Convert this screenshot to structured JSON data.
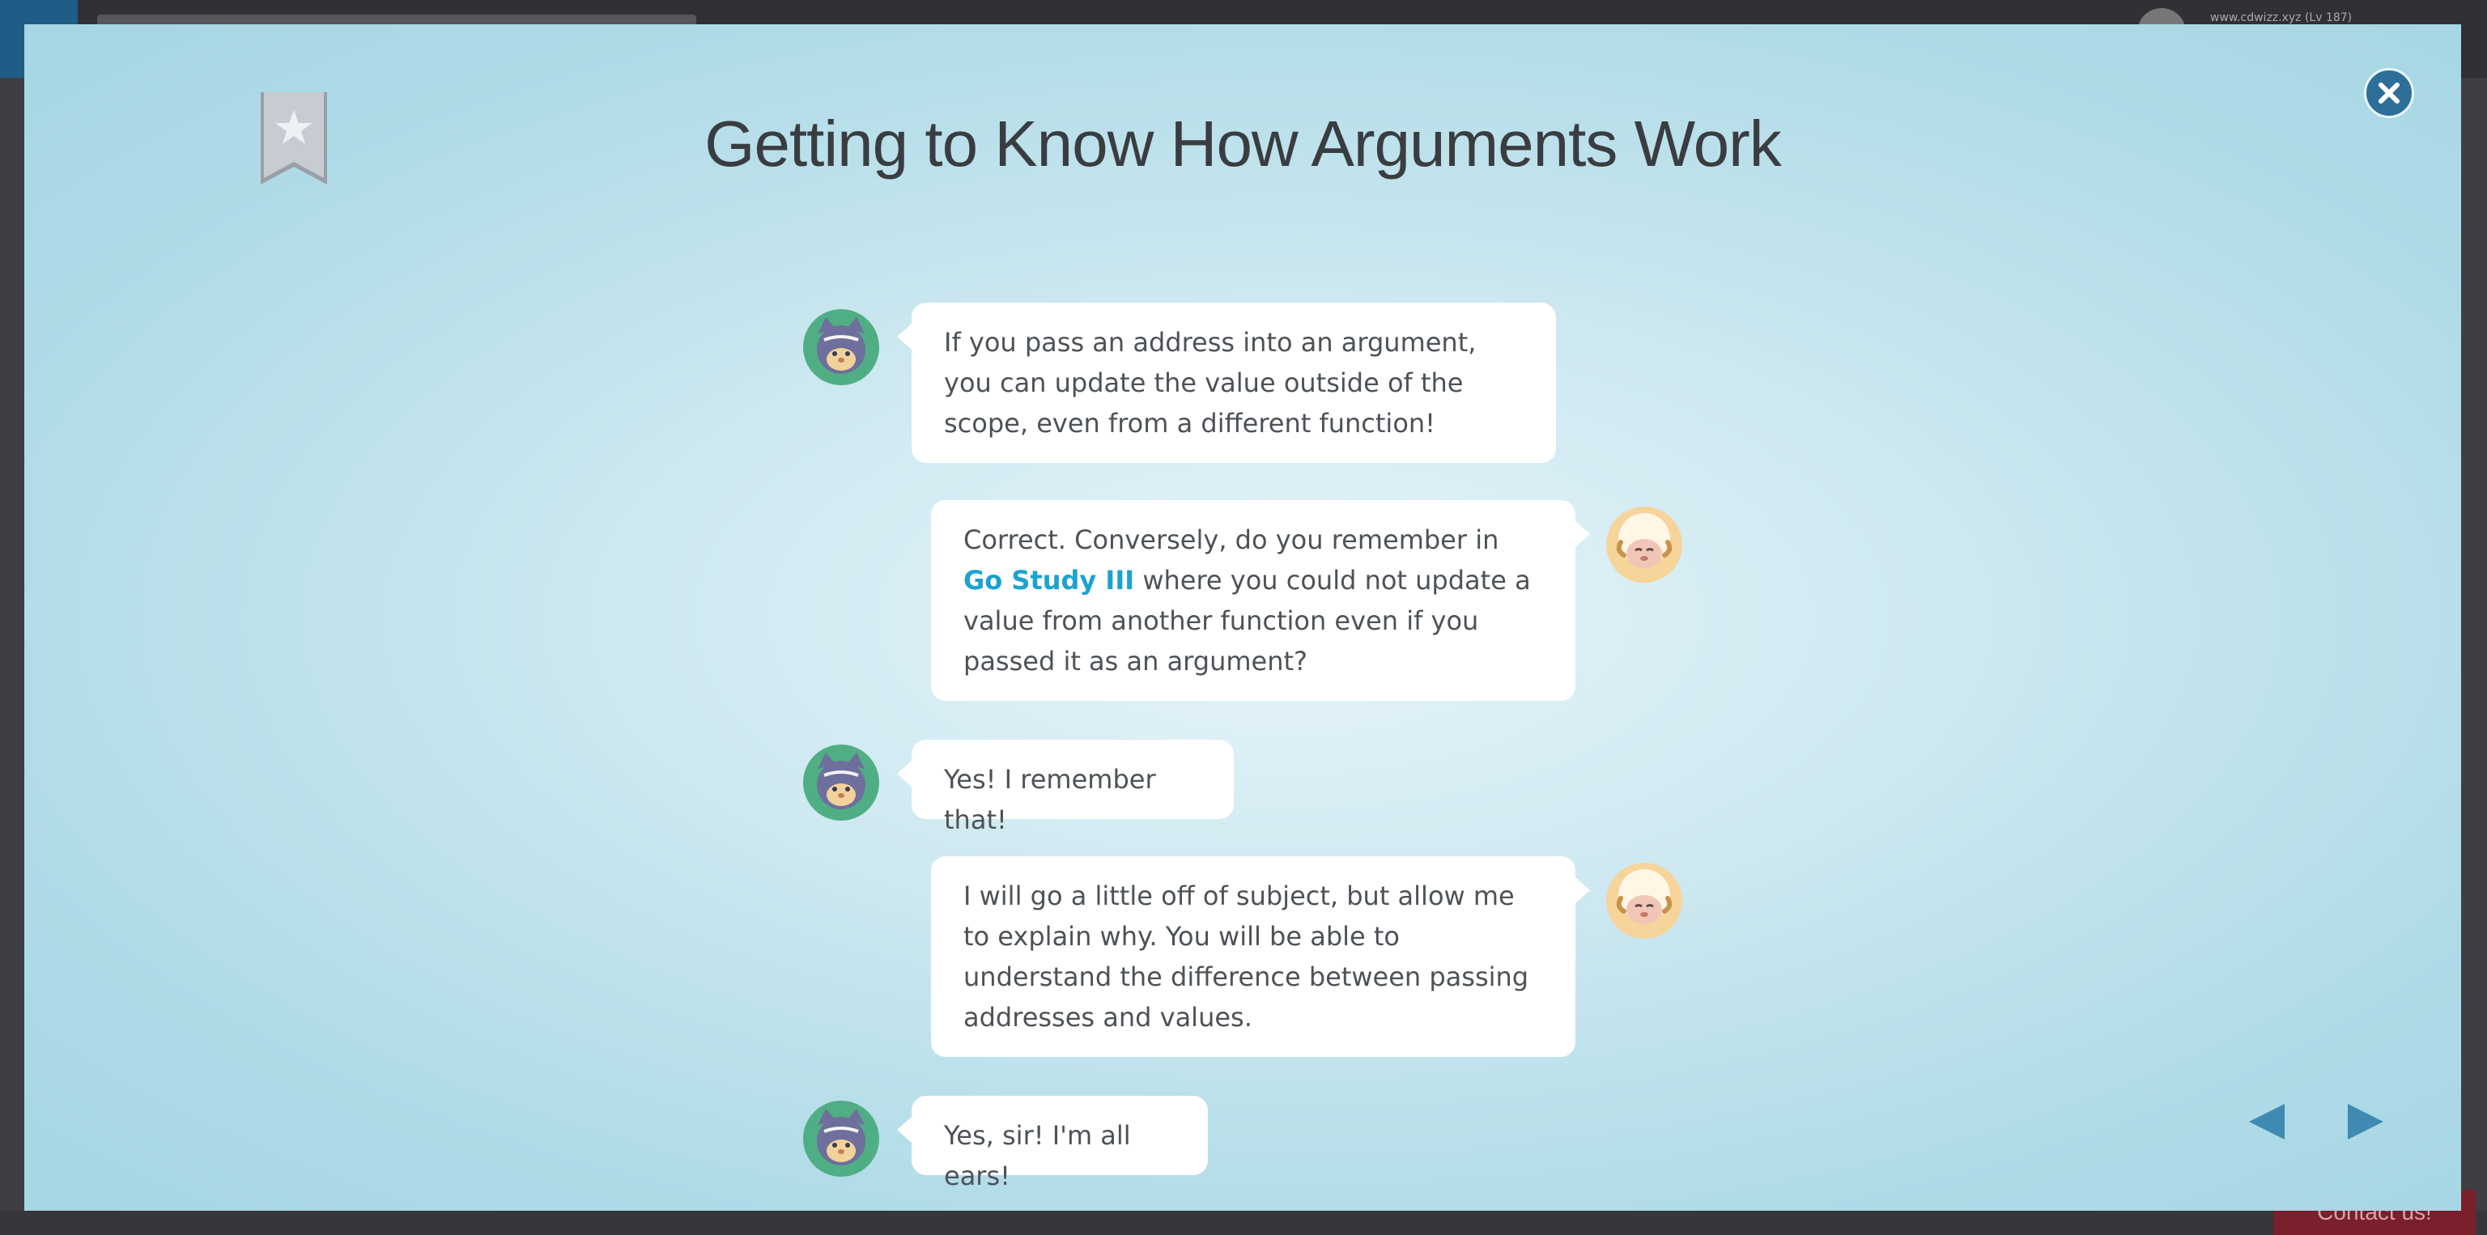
{
  "background": {
    "user_info": "www.cdwizz.xyz (Lv 187)",
    "contact_label": "Contact us!"
  },
  "modal": {
    "title": "Getting to Know How Arguments Work",
    "close_icon": "close-icon",
    "bookmark_icon": "star-bookmark-icon",
    "colors": {
      "accent": "#2e6f99",
      "link": "#1ca2cf",
      "text": "#4d5257"
    }
  },
  "dialogue": [
    {
      "speaker": "cat",
      "text": "If you pass an address into an argument, you can update the value outside of the scope, even from a different function!"
    },
    {
      "speaker": "sheep",
      "text_before": "Correct. Conversely, do you remember in ",
      "link_text": "Go Study III",
      "text_after": " where you could not update a value from another function even if you passed it as an argument?"
    },
    {
      "speaker": "cat",
      "text": "Yes! I remember that!"
    },
    {
      "speaker": "sheep",
      "text": "I will go a little off of subject, but allow me to explain why. You will be able to understand the difference between passing addresses and values."
    },
    {
      "speaker": "cat",
      "text": "Yes, sir! I'm all ears!"
    }
  ],
  "navigation": {
    "prev_icon": "prev-arrow-icon",
    "next_icon": "next-arrow-icon"
  }
}
